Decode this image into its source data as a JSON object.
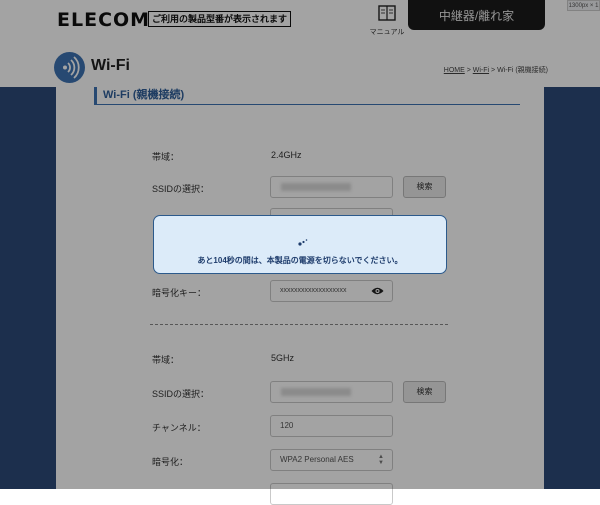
{
  "header": {
    "logo": "ELECOM",
    "model_notice": "ご利用の製品型番が表示されます",
    "manual_label": "マニュアル",
    "mode_tab": "中継器/離れ家",
    "resolution_badge": "1300px × 1"
  },
  "title": {
    "page_title": "Wi-Fi",
    "breadcrumb": {
      "home": "HOME",
      "sep1": " > ",
      "wifi": "Wi-Fi",
      "sep2": " > ",
      "current": "Wi-Fi (親機接続)"
    }
  },
  "section": {
    "title": "Wi-Fi (親機接続)"
  },
  "band_24": {
    "band_label": "帯域：",
    "band_value": "2.4GHz",
    "ssid_label": "SSIDの選択：",
    "search_button": "検索",
    "key_label": "暗号化キー：",
    "key_value": "xxxxxxxxxxxxxxxxxxx"
  },
  "band_5": {
    "band_label": "帯域：",
    "band_value": "5GHz",
    "ssid_label": "SSIDの選択：",
    "search_button": "検索",
    "channel_label": "チャンネル：",
    "channel_value": "120",
    "enc_label": "暗号化：",
    "enc_value": "WPA2 Personal AES"
  },
  "modal": {
    "message": "あと104秒の間は、本製品の電源を切らないでください。"
  },
  "colors": {
    "accent": "#3d73b3",
    "side_blue": "#2c4a79",
    "modal_bg": "#dcebf9",
    "tab_bg": "#1b1b1b"
  }
}
